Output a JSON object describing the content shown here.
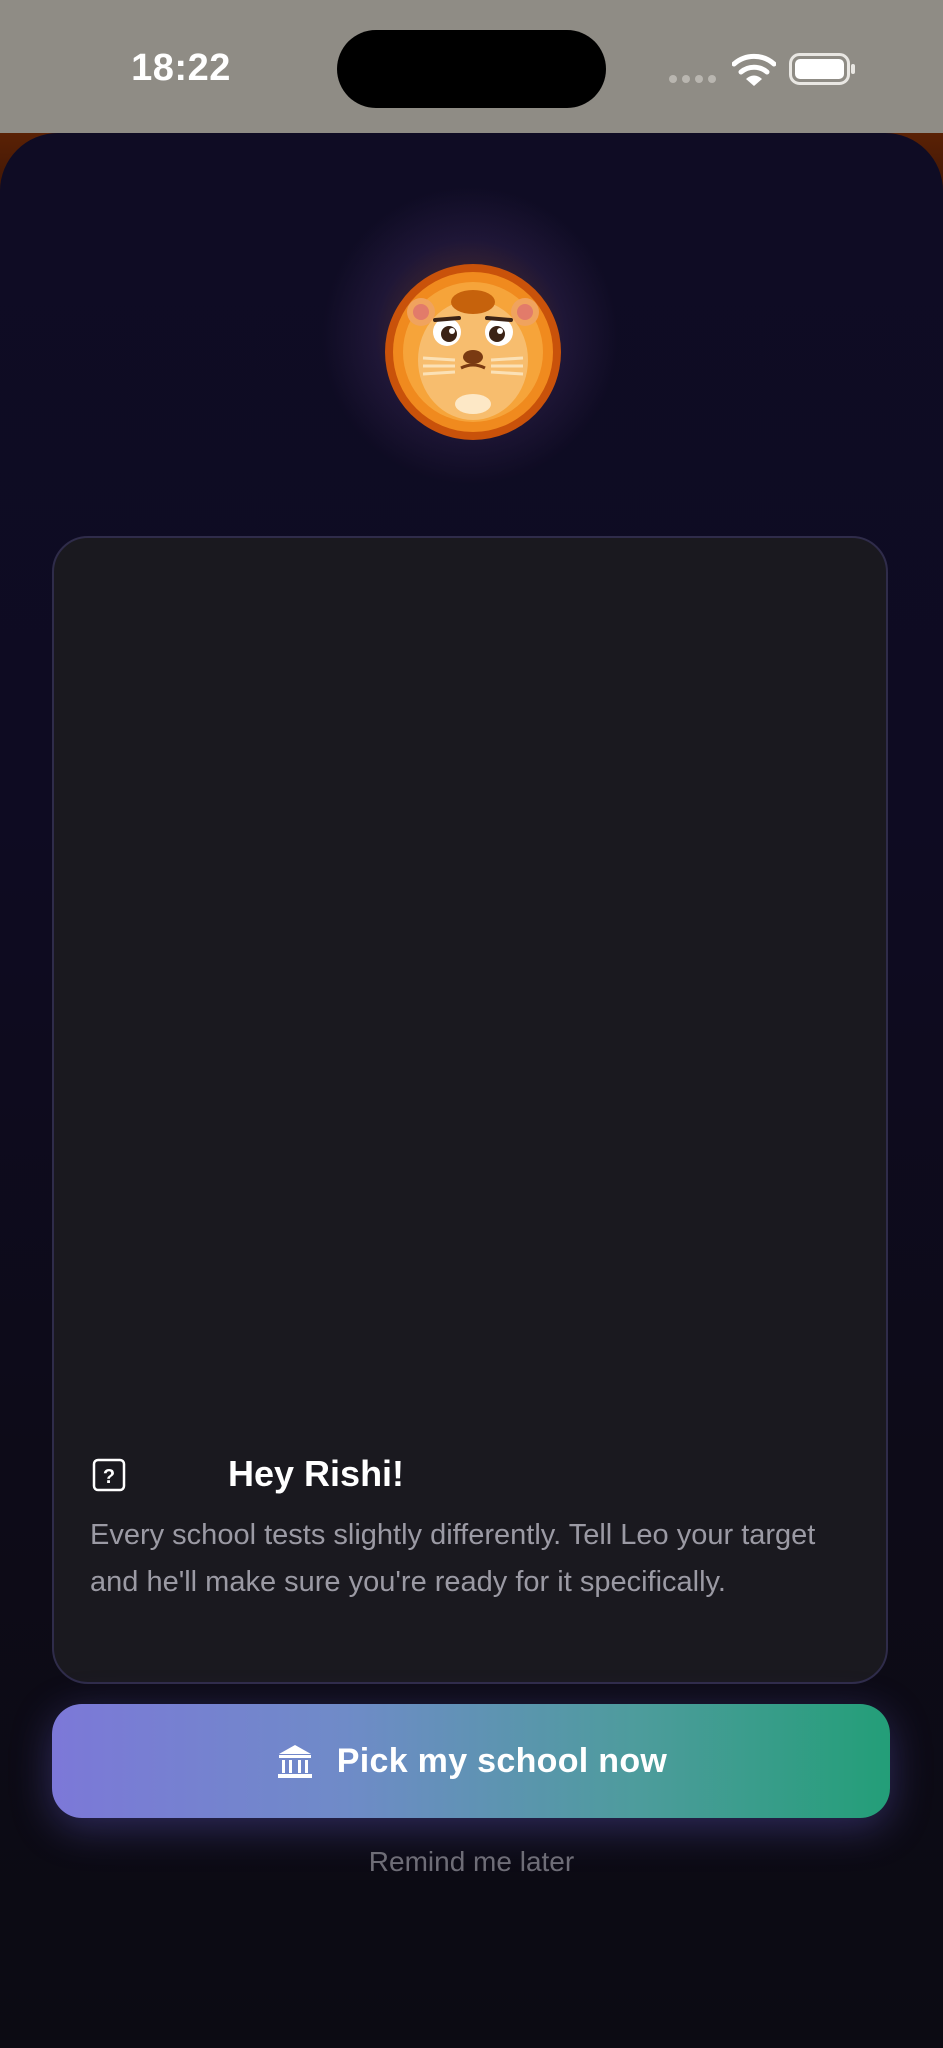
{
  "status_bar": {
    "time": "18:22",
    "icons": [
      "signal-dots-icon",
      "wifi-icon",
      "battery-icon"
    ]
  },
  "mascot": {
    "icon": "lion-mascot-icon"
  },
  "card": {
    "help_icon": "question-mark-icon",
    "greeting": "Hey Rishi!",
    "message": "Every school tests slightly differently. Tell Leo your target and he'll make sure you're ready for it specifically."
  },
  "actions": {
    "primary_icon": "bank-building-icon",
    "primary_label": "Pick my school now",
    "secondary_label": "Remind me later"
  },
  "colors": {
    "button_gradient_start": "#7c78d8",
    "button_gradient_end": "#239e78",
    "card_background": "#1a191f",
    "sheet_background": "#0f0c24"
  }
}
